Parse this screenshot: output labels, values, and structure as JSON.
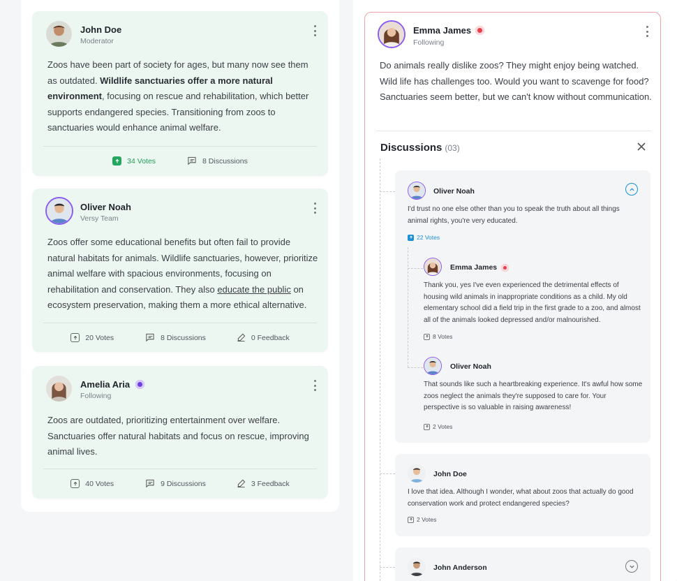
{
  "feed": {
    "cards": [
      {
        "author": "John Doe",
        "role": "Moderator",
        "body_parts": [
          "Zoos have been part of society for ages, but many now see them as outdated. ",
          "Wildlife sanctuaries offer a more natural environment",
          ", focusing on rescue and rehabilitation, which better supports endangered species. Transitioning from zoos to sanctuaries would enhance animal welfare."
        ],
        "votes": "34 Votes",
        "discussions": "8 Discussions"
      },
      {
        "author": "Oliver Noah",
        "role": "Versy Team",
        "body_parts": [
          "Zoos offer some educational benefits but often fail to provide natural habitats for animals. Wildlife sanctuaries, however, prioritize animal welfare with spacious environments, focusing on rehabilitation and conservation. They also ",
          "educate the public",
          " on ecosystem preservation, making them a more ethical alternative."
        ],
        "votes": "20 Votes",
        "discussions": "8 Discussions",
        "feedback": "0 Feedback"
      },
      {
        "author": "Amelia Aria",
        "role": "Following",
        "body": "Zoos are outdated, prioritizing entertainment over welfare. Sanctuaries offer natural habitats and focus on rescue, improving animal lives.",
        "votes": "40 Votes",
        "discussions": "9 Discussions",
        "feedback": "3 Feedback"
      }
    ]
  },
  "post": {
    "author": "Emma James",
    "role": "Following",
    "body": "Do animals really dislike zoos? They might enjoy being watched. Wild life has challenges too. Would you want to scavenge for food? Sanctuaries seem better, but we can't know without communication.",
    "discussions_title": "Discussions",
    "discussions_count": "(03)"
  },
  "comments": {
    "c1": {
      "author": "Oliver Noah",
      "text": "I'd trust no one else other than you to speak the truth about all things animal rights, you're very educated.",
      "votes": "22 Votes"
    },
    "r1": {
      "author": "Emma James",
      "text": "Thank you, yes I've even experienced the detrimental effects of housing wild animals in inappropriate conditions as a child. My old elementary school did a field trip in the first grade to a zoo, and almost all of the animals looked depressed and/or malnourished.",
      "votes": "8 Votes"
    },
    "r2": {
      "author": "Oliver Noah",
      "text": "That sounds like such a heartbreaking experience. It's awful how some zoos neglect the animals they're supposed to care for. Your perspective is so valuable in raising awareness!",
      "votes": "2 Votes"
    },
    "c2": {
      "author": "John Doe",
      "text": "I love that idea. Although I wonder, what about zoos that actually do good conservation work and protect endangered species?",
      "votes": "2 Votes"
    },
    "c3": {
      "author": "John Anderson"
    }
  },
  "colors": {
    "card_bg": "#edf7f1",
    "accent_green": "#22a85e",
    "accent_blue": "#1c8fd6",
    "post_border": "#f0a3a8",
    "avatar_ring": "#8a5cf0"
  },
  "icons": [
    "kebab-icon",
    "upvote-icon",
    "discussion-icon",
    "feedback-icon",
    "close-icon",
    "chevron-up-icon",
    "chevron-down-icon",
    "badge-icon"
  ]
}
